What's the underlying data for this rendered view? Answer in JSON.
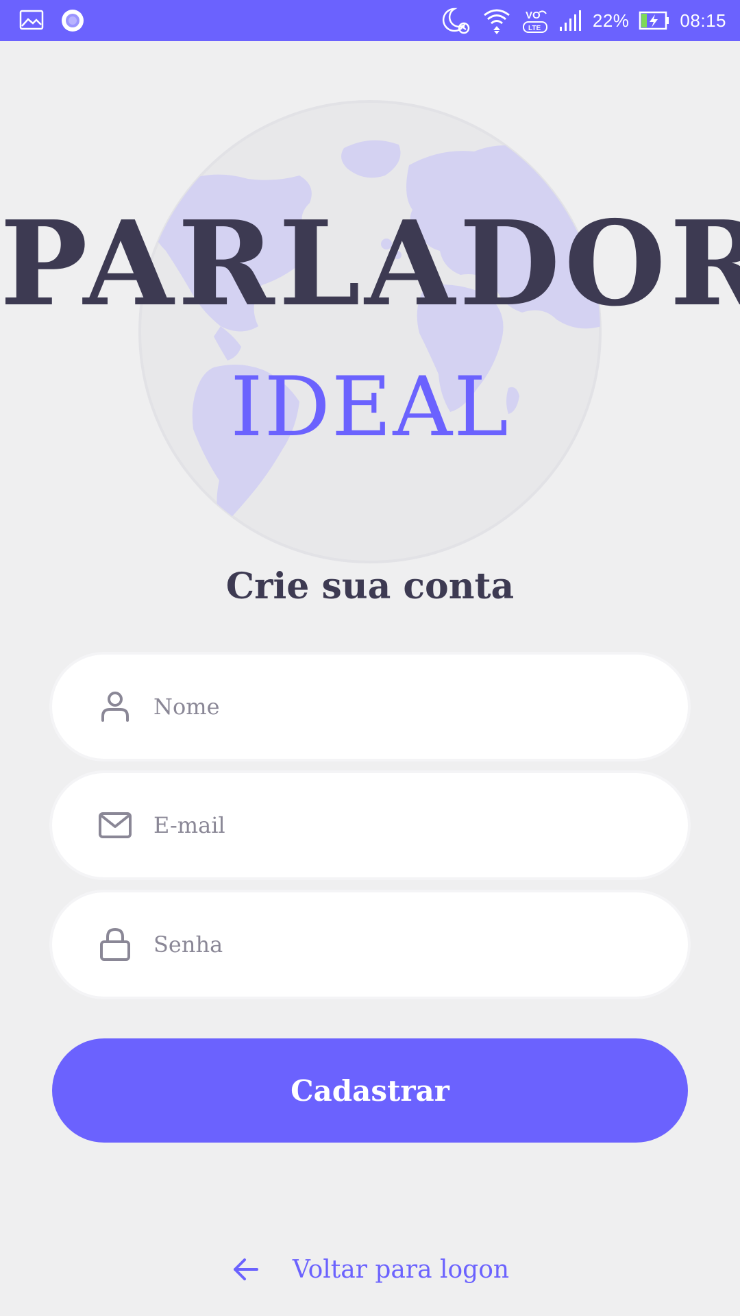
{
  "status_bar": {
    "battery_percent": "22%",
    "time": "08:15",
    "network_label": "VO LTE"
  },
  "brand": {
    "title": "PARLADOR",
    "subtitle": "IDEAL"
  },
  "page": {
    "title": "Crie sua conta"
  },
  "form": {
    "name_placeholder": "Nome",
    "email_placeholder": "E-mail",
    "password_placeholder": "Senha",
    "submit_label": "Cadastrar"
  },
  "footer": {
    "back_label": "Voltar para logon"
  },
  "colors": {
    "accent": "#6b62fe",
    "text_dark": "#3d3a52",
    "background": "#efeff0",
    "globe": "#d4d2f2"
  }
}
